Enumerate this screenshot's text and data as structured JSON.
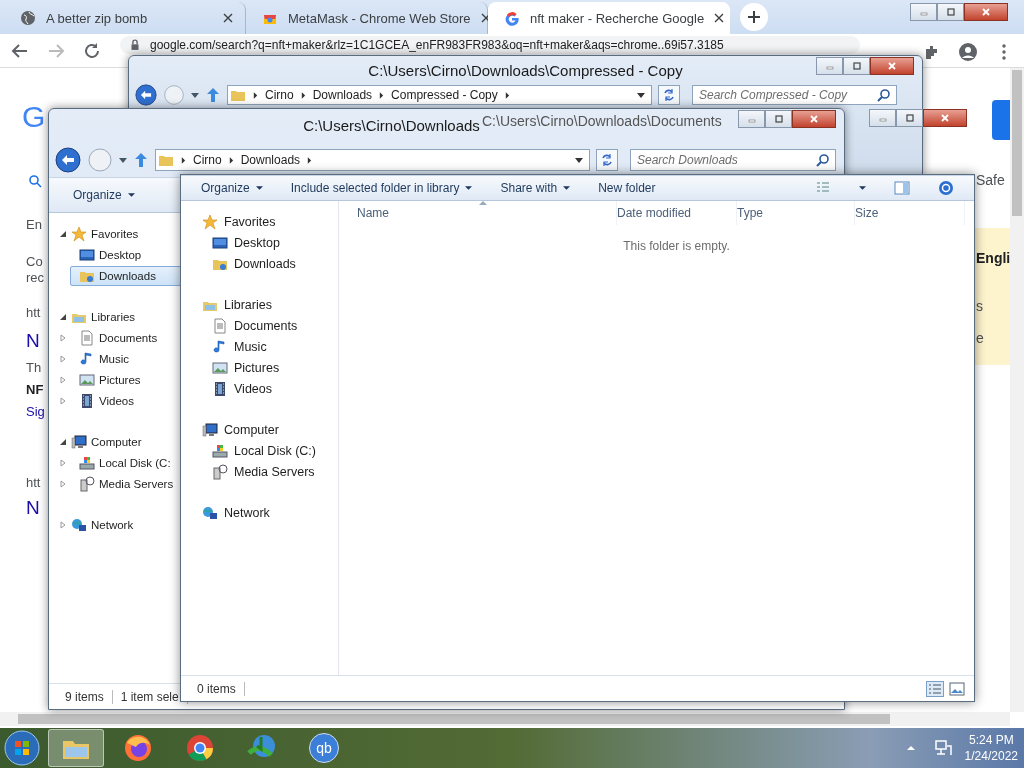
{
  "browser": {
    "tabs": [
      {
        "title": "A better zip bomb",
        "kind": "globe",
        "selected": false
      },
      {
        "title": "MetaMask - Chrome Web Store",
        "kind": "store",
        "selected": false
      },
      {
        "title": "nft maker - Recherche Google",
        "kind": "google",
        "selected": true
      }
    ],
    "url": "google.com/search?q=nft+maker&rlz=1C1GCEA_enFR983FR983&oq=nft+maker&aqs=chrome..69i57.3185"
  },
  "google_page": {
    "logo": "G",
    "left_texts": [
      {
        "text": "En",
        "kind": "plain"
      },
      {
        "text": "Co",
        "kind": "plain"
      },
      {
        "text": "rec",
        "kind": "plain"
      },
      {
        "text": "htt",
        "kind": "plain"
      },
      {
        "text": "N",
        "kind": "title"
      },
      {
        "text": "Th",
        "kind": "plain"
      },
      {
        "text": "NF",
        "kind": "bold"
      },
      {
        "text": "Sig",
        "kind": "link"
      },
      {
        "text": "htt",
        "kind": "plain"
      },
      {
        "text": "N",
        "kind": "title"
      }
    ],
    "right_texts": [
      {
        "text": "Safe",
        "kind": "plain"
      },
      {
        "text": "Engli",
        "kind": "bold"
      },
      {
        "text": "s",
        "kind": "plain"
      },
      {
        "text": "e",
        "kind": "plain"
      }
    ]
  },
  "compressed_window": {
    "title": "C:\\Users\\Cirno\\Downloads\\Compressed - Copy",
    "breadcrumb": [
      "Cirno",
      "Downloads",
      "Compressed - Copy"
    ],
    "search": {
      "placeholder": "Search Compressed - Copy"
    }
  },
  "downloads_window": {
    "title": "C:\\Users\\Cirno\\Downloads",
    "breadcrumb": [
      "Cirno",
      "Downloads"
    ],
    "search": {
      "placeholder": "Search Downloads"
    },
    "toolbar": [
      "Organize"
    ],
    "nav": [
      {
        "label": "Favorites",
        "kind": "star",
        "expanded": true,
        "selected": false,
        "children": [
          {
            "label": "Desktop",
            "kind": "desktop",
            "selected": false
          },
          {
            "label": "Downloads",
            "kind": "downloads",
            "selected": true
          }
        ]
      },
      {
        "label": "Libraries",
        "kind": "library",
        "expanded": true,
        "selected": false,
        "children": [
          {
            "label": "Documents",
            "kind": "documents",
            "expanded": false,
            "selected": false
          },
          {
            "label": "Music",
            "kind": "music",
            "expanded": false,
            "selected": false
          },
          {
            "label": "Pictures",
            "kind": "pictures",
            "expanded": false,
            "selected": false
          },
          {
            "label": "Videos",
            "kind": "videos",
            "expanded": false,
            "selected": false
          }
        ]
      },
      {
        "label": "Computer",
        "kind": "computer",
        "expanded": true,
        "selected": false,
        "children": [
          {
            "label": "Local Disk (C:",
            "kind": "disk",
            "expanded": false,
            "selected": false
          },
          {
            "label": "Media Servers",
            "kind": "media",
            "expanded": false,
            "selected": false
          }
        ]
      },
      {
        "label": "Network",
        "kind": "network",
        "expanded": false,
        "selected": false
      }
    ],
    "status": [
      "9 items",
      "1 item sele"
    ]
  },
  "documents_window": {
    "title": "C:\\Users\\Cirno\\Downloads\\Documents",
    "toolbar": [
      {
        "label": "Organize",
        "dropdown": true
      },
      {
        "label": "Include selected folder in library",
        "dropdown": true
      },
      {
        "label": "Share with",
        "dropdown": true
      },
      {
        "label": "New folder",
        "dropdown": false
      }
    ],
    "nav": [
      {
        "label": "Favorites",
        "kind": "star",
        "selected": false,
        "children": [
          {
            "label": "Desktop",
            "kind": "desktop",
            "selected": false
          },
          {
            "label": "Downloads",
            "kind": "downloads",
            "selected": false
          }
        ]
      },
      {
        "label": "Libraries",
        "kind": "library",
        "selected": false,
        "children": [
          {
            "label": "Documents",
            "kind": "documents",
            "selected": false
          },
          {
            "label": "Music",
            "kind": "music",
            "selected": false
          },
          {
            "label": "Pictures",
            "kind": "pictures",
            "selected": false
          },
          {
            "label": "Videos",
            "kind": "videos",
            "selected": false
          }
        ]
      },
      {
        "label": "Computer",
        "kind": "computer",
        "selected": false,
        "children": [
          {
            "label": "Local Disk (C:)",
            "kind": "disk",
            "selected": false
          },
          {
            "label": "Media Servers",
            "kind": "media",
            "selected": false
          }
        ]
      },
      {
        "label": "Network",
        "kind": "network",
        "selected": false
      }
    ],
    "columns": [
      "Name",
      "Date modified",
      "Type",
      "Size"
    ],
    "empty_message": "This folder is empty.",
    "status": "0 items"
  },
  "taskbar": {
    "apps": [
      {
        "kind": "explorer",
        "selected": true
      },
      {
        "kind": "firefox",
        "selected": false
      },
      {
        "kind": "chrome",
        "selected": false
      },
      {
        "kind": "downloader",
        "selected": false
      },
      {
        "kind": "qb",
        "label": "qb",
        "selected": false
      }
    ],
    "time": "5:24 PM",
    "date": "1/24/2022"
  }
}
